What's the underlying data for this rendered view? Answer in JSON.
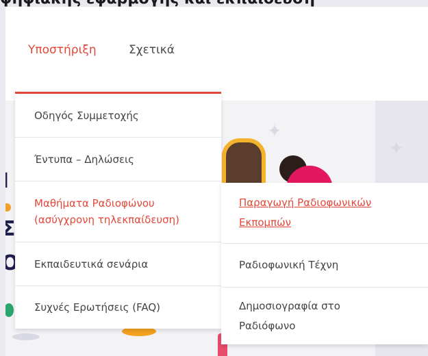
{
  "top_strip": {
    "cut_text": "ψηφιακής εφαρμογής και εκπαίδευση"
  },
  "nav": {
    "support": "Υποστήριξη",
    "about": "Σχετικά"
  },
  "dropdown": {
    "items": [
      "Οδηγός Συμμετοχής",
      "Έντυπα – Δηλώσεις",
      "Μαθήματα Ραδιοφώνου\n(ασύγχρονη τηλεκπαίδευση)",
      "Εκπαιδευτικά σενάρια",
      "Συχνές Ερωτήσεις (FAQ)"
    ]
  },
  "submenu": {
    "items": [
      "Παραγωγή Ραδιοφωνικών\nΕκπομπών",
      "Ραδιοφωνική Τέχνη",
      "Δημοσιογραφία στο\nΡαδιόφωνο"
    ]
  },
  "colors": {
    "accent": "#e2483a",
    "text": "#444444",
    "background": "#e9e9ef"
  }
}
